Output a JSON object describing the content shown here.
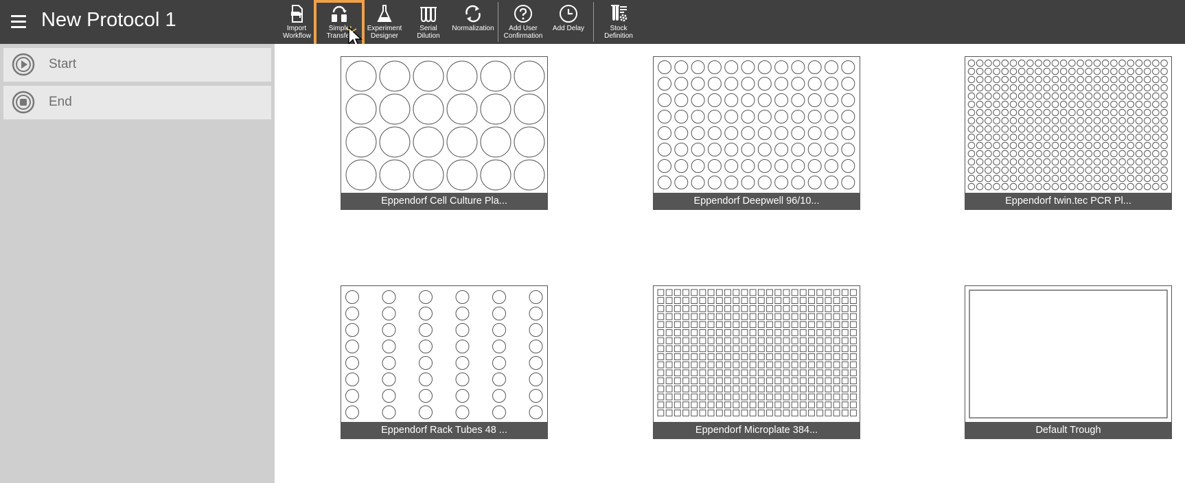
{
  "app": {
    "title": "New Protocol 1"
  },
  "toolbar": {
    "items": [
      {
        "key": "import",
        "line1": "Import",
        "line2": "Workflow"
      },
      {
        "key": "simple-transfer",
        "line1": "Simple",
        "line2": "Transfer"
      },
      {
        "key": "experiment-designer",
        "line1": "Experiment",
        "line2": "Designer"
      },
      {
        "key": "serial-dilution",
        "line1": "Serial",
        "line2": "Dilution"
      },
      {
        "key": "normalization",
        "line1": "Normalization",
        "line2": ""
      },
      {
        "key": "add-user-confirmation",
        "line1": "Add User",
        "line2": "Confirmation"
      },
      {
        "key": "add-delay",
        "line1": "Add Delay",
        "line2": ""
      },
      {
        "key": "stock-definition",
        "line1": "Stock",
        "line2": "Definition"
      }
    ]
  },
  "sidebar": {
    "steps": [
      {
        "label": "Start",
        "icon": "play-circle-icon"
      },
      {
        "label": "End",
        "icon": "stop-circle-icon"
      }
    ]
  },
  "labware": [
    {
      "name": "Eppendorf Cell Culture Pla...",
      "layout": "24-well"
    },
    {
      "name": "Eppendorf Deepwell 96/10...",
      "layout": "96-well"
    },
    {
      "name": "Eppendorf twin.tec PCR Pl...",
      "layout": "384-round"
    },
    {
      "name": "Eppendorf Rack Tubes 48 ...",
      "layout": "48-tubes"
    },
    {
      "name": "Eppendorf Microplate 384...",
      "layout": "384-square"
    },
    {
      "name": "Default Trough",
      "layout": "trough"
    }
  ],
  "colors": {
    "topbar": "#404040",
    "highlight": "#f0a04b",
    "sidebar": "#cfcfcf",
    "label_bar": "#555555"
  }
}
